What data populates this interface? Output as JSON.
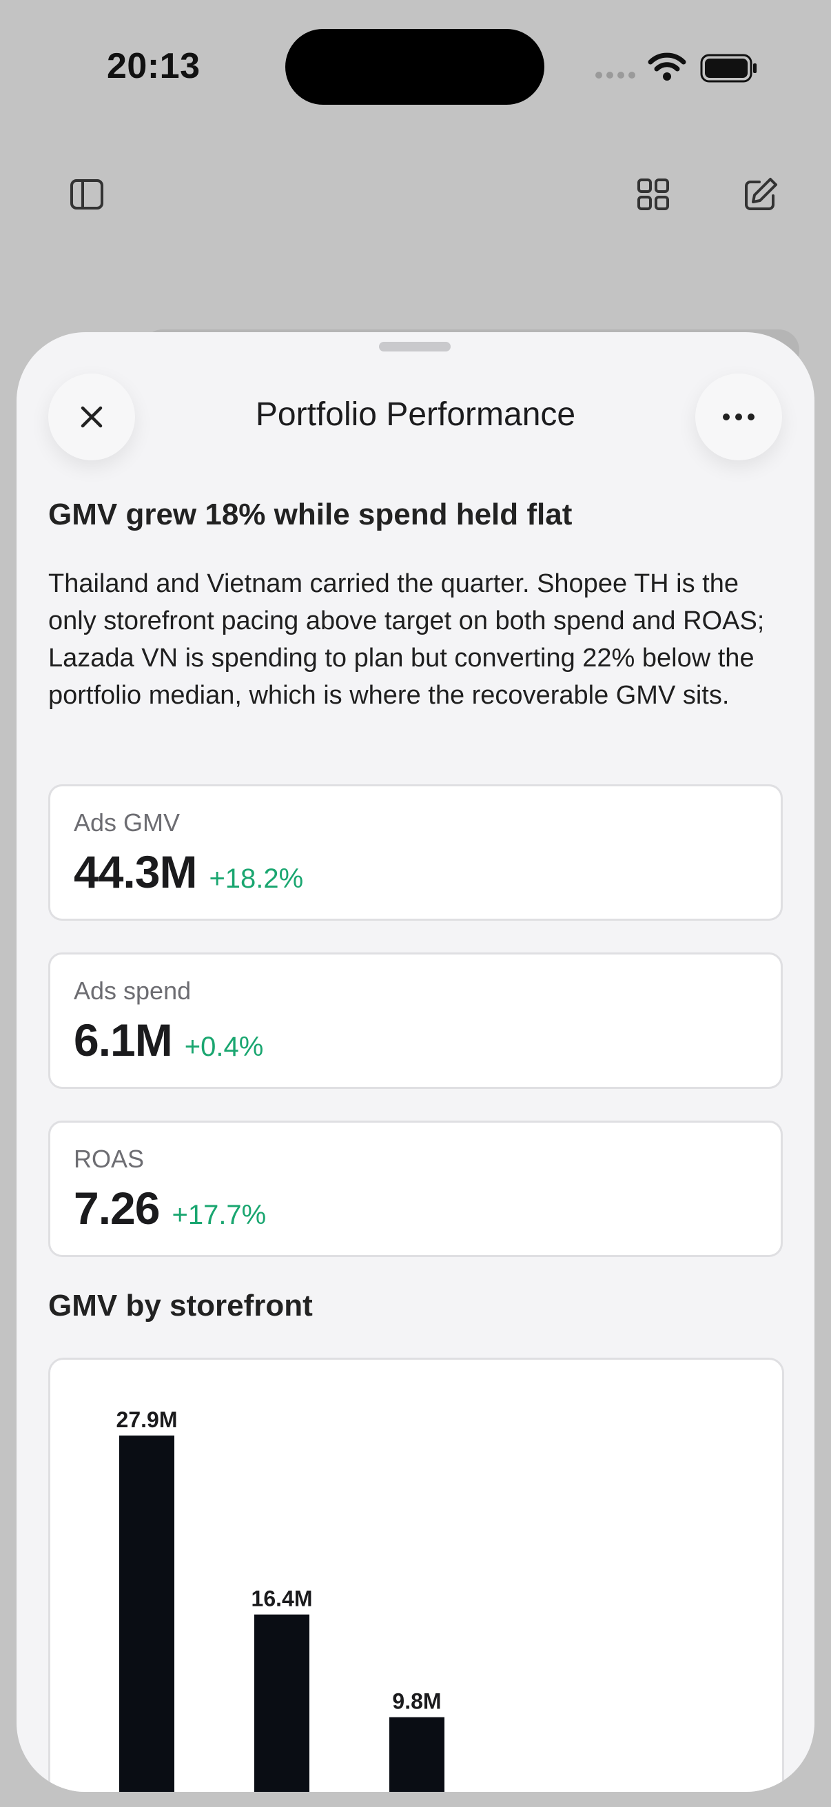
{
  "status_bar": {
    "time": "20:13"
  },
  "toolbar": {
    "sidebar_icon": "sidebar-icon",
    "grid_icon": "grid-icon",
    "compose_icon": "compose-icon"
  },
  "sheet": {
    "title": "Portfolio Performance",
    "close_icon": "close-icon",
    "more_icon": "ellipsis-icon"
  },
  "summary": {
    "headline": "GMV grew 18% while spend held flat",
    "body": "Thailand and Vietnam carried the quarter. Shopee TH is the only storefront pacing above target on both spend and ROAS; Lazada VN is spending to plan but converting 22% below the portfolio median, which is where the recoverable GMV sits."
  },
  "kpis": [
    {
      "label": "Ads GMV",
      "value": "44.3M",
      "delta": "+18.2%"
    },
    {
      "label": "Ads spend",
      "value": "6.1M",
      "delta": "+0.4%"
    },
    {
      "label": "ROAS",
      "value": "7.26",
      "delta": "+17.7%"
    }
  ],
  "colors": {
    "positive": "#1aa670",
    "bar": "#0a0d14",
    "background": "#c3c3c3",
    "sheet": "#f4f4f6"
  },
  "chart_section": {
    "title": "GMV by storefront"
  },
  "chart_data": {
    "type": "bar",
    "title": "GMV by storefront",
    "categories": [
      "",
      "",
      ""
    ],
    "values": [
      27.9,
      16.4,
      9.8
    ],
    "labels": [
      "27.9M",
      "16.4M",
      "9.8M"
    ],
    "ylim": [
      0,
      30
    ],
    "grid": false
  }
}
